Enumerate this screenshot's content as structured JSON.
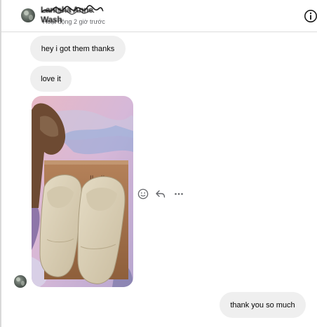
{
  "contact": {
    "name": "Lanisha Anne Wash",
    "status": "Hoạt động 2 giờ trước"
  },
  "messages": [
    {
      "from": "contact",
      "type": "text",
      "text": "hey i got them thanks"
    },
    {
      "from": "contact",
      "type": "text",
      "text": "love it"
    },
    {
      "from": "contact",
      "type": "image",
      "description": "beige slide sandals on box"
    },
    {
      "from": "me",
      "type": "text",
      "text": "thank you so much"
    }
  ],
  "message_actions": [
    {
      "icon": "smiley-icon",
      "label": "React"
    },
    {
      "icon": "reply-icon",
      "label": "Reply"
    },
    {
      "icon": "more-icon",
      "label": "More"
    }
  ],
  "icons": {
    "header_info": "info-icon"
  },
  "colors": {
    "bubble": "#efefef",
    "status_text": "#65676b"
  }
}
